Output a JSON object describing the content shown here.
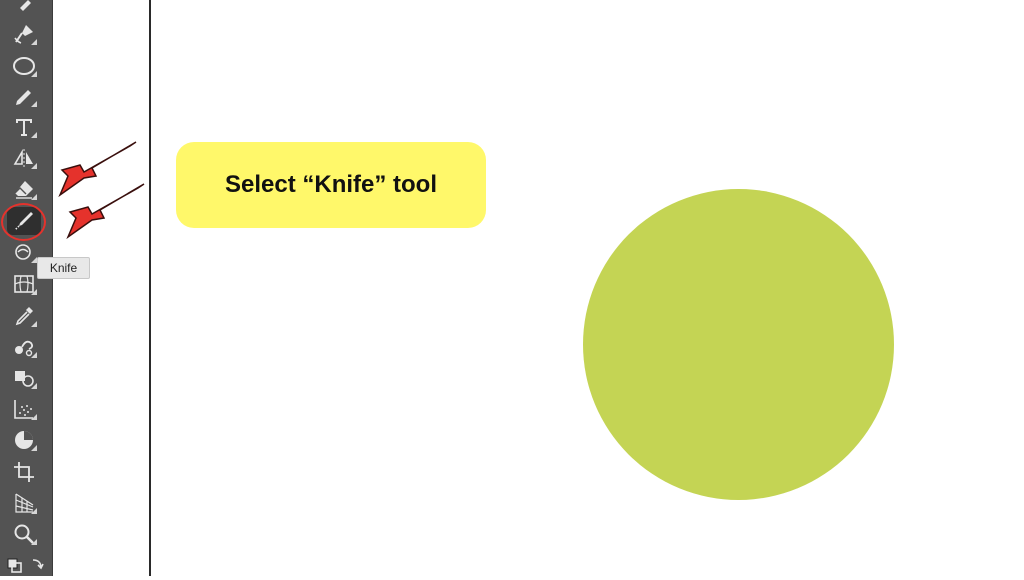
{
  "toolbar": {
    "tools": [
      {
        "name": "pencil-partial-tool",
        "icon": "pencil-icon"
      },
      {
        "name": "pen-tool",
        "icon": "pen-icon"
      },
      {
        "name": "ellipse-tool",
        "icon": "ellipse-icon"
      },
      {
        "name": "pencil-tool",
        "icon": "pencil-icon"
      },
      {
        "name": "type-tool",
        "icon": "type-icon"
      },
      {
        "name": "reflect-tool",
        "icon": "reflect-icon"
      },
      {
        "name": "eraser-tool",
        "icon": "eraser-icon"
      },
      {
        "name": "knife-tool",
        "icon": "knife-icon",
        "active": true
      },
      {
        "name": "warp-tool",
        "icon": "warp-icon"
      },
      {
        "name": "mesh-tool",
        "icon": "mesh-icon"
      },
      {
        "name": "eyedropper-tool",
        "icon": "eyedropper-icon"
      },
      {
        "name": "blend-tool",
        "icon": "blend-icon"
      },
      {
        "name": "shape-builder-tool",
        "icon": "shape-builder-icon"
      },
      {
        "name": "symbol-sprayer-tool",
        "icon": "symbol-sprayer-icon"
      },
      {
        "name": "pie-graph-tool",
        "icon": "pie-graph-icon"
      },
      {
        "name": "artboard-tool",
        "icon": "artboard-icon"
      },
      {
        "name": "perspective-grid-tool",
        "icon": "perspective-grid-icon"
      },
      {
        "name": "zoom-tool",
        "icon": "zoom-icon"
      },
      {
        "name": "swap-fill-stroke",
        "icon": "swap-icon"
      }
    ]
  },
  "tooltip": {
    "label": "Knife"
  },
  "callout": {
    "text": "Select “Knife” tool"
  },
  "colors": {
    "toolbar_bg": "#535353",
    "callout_bg": "#fff86a",
    "circle_fill": "#c4d454",
    "arrow_fill": "#e5322c",
    "highlight_ring": "#e5322c"
  }
}
